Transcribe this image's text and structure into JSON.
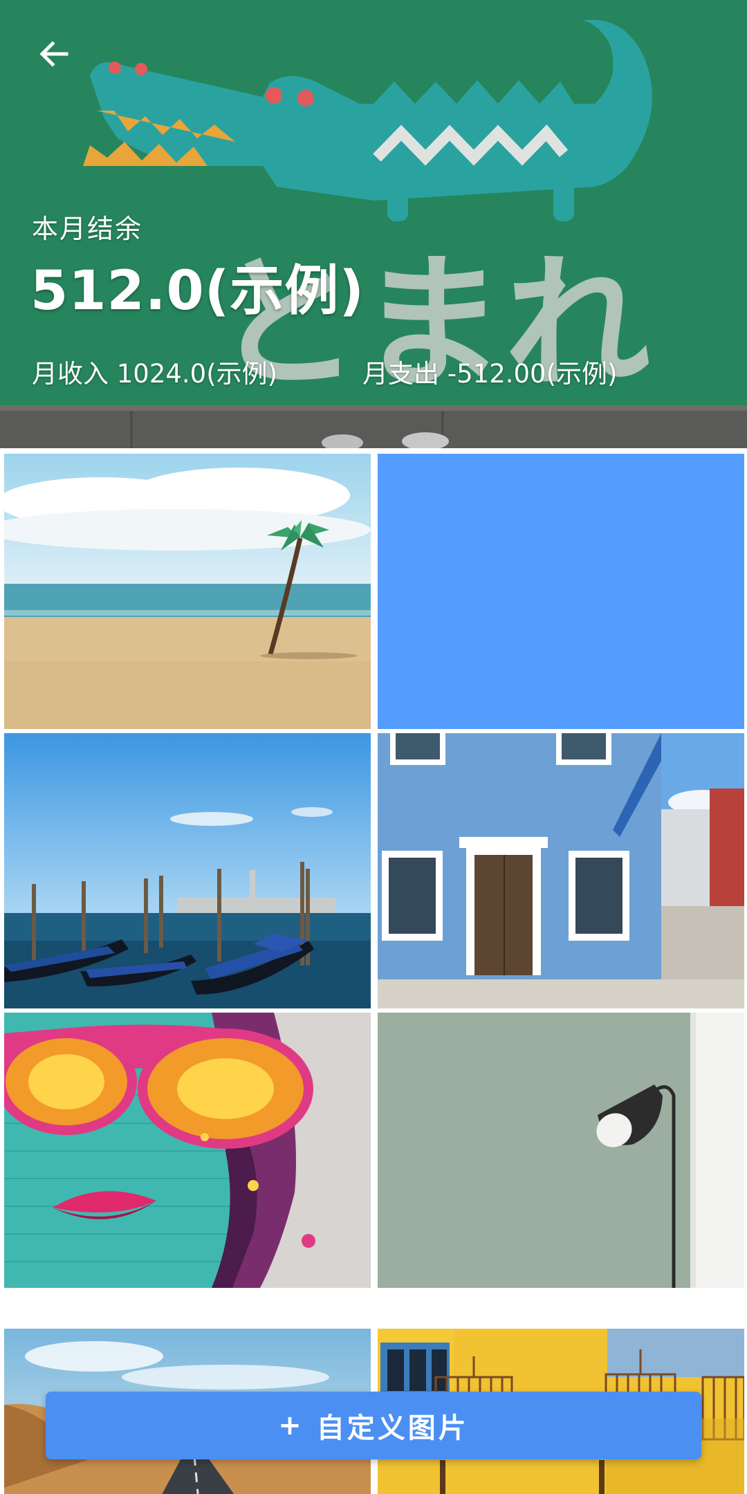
{
  "header": {
    "balance_label": "本月结余",
    "balance_value": "512.0(示例)",
    "income_text": "月收入 1024.0(示例)",
    "expense_text": "月支出 -512.00(示例)",
    "background_text": "とまれ"
  },
  "grid": {
    "tiles": [
      {
        "id": "beach-palm"
      },
      {
        "id": "solid-blue",
        "color": "#559cff"
      },
      {
        "id": "venice-gondolas"
      },
      {
        "id": "blue-house"
      },
      {
        "id": "graffiti-face"
      },
      {
        "id": "lamp-wall"
      },
      {
        "id": "desert-road"
      },
      {
        "id": "yellow-birdcages"
      }
    ]
  },
  "actions": {
    "custom_plus": "+",
    "custom_label": "自定义图片"
  },
  "colors": {
    "accent": "#4b8ff2",
    "solid_tile": "#559cff"
  }
}
